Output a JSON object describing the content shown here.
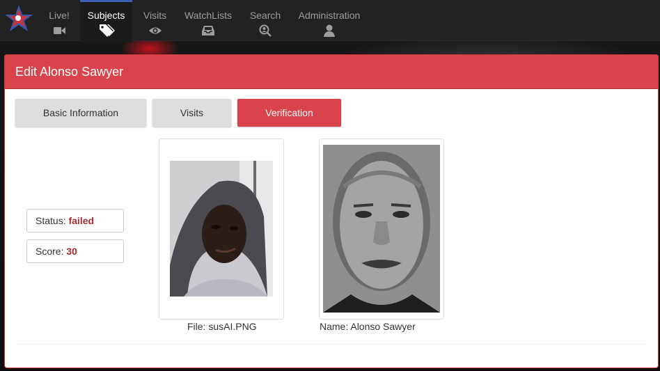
{
  "navbar": {
    "items": [
      {
        "label": "Live!",
        "icon": "video-camera-icon"
      },
      {
        "label": "Subjects",
        "icon": "tags-icon",
        "active": true
      },
      {
        "label": "Visits",
        "icon": "eye-icon"
      },
      {
        "label": "WatchLists",
        "icon": "inbox-icon"
      },
      {
        "label": "Search",
        "icon": "search-face-icon"
      },
      {
        "label": "Administration",
        "icon": "user-icon"
      }
    ]
  },
  "panel": {
    "title": "Edit Alonso Sawyer",
    "tabs": [
      {
        "label": "Basic Information"
      },
      {
        "label": "Visits"
      },
      {
        "label": "Verification",
        "active": true
      }
    ]
  },
  "verification": {
    "status_label": "Status:",
    "status_value": "failed",
    "score_label": "Score:",
    "score_value": "30",
    "file_caption": "File: susAI.PNG",
    "name_caption": "Name: Alonso Sawyer"
  },
  "colors": {
    "accent": "#d9434b",
    "nav_active_border": "#3d5fb8",
    "value_text": "#a72b30"
  }
}
